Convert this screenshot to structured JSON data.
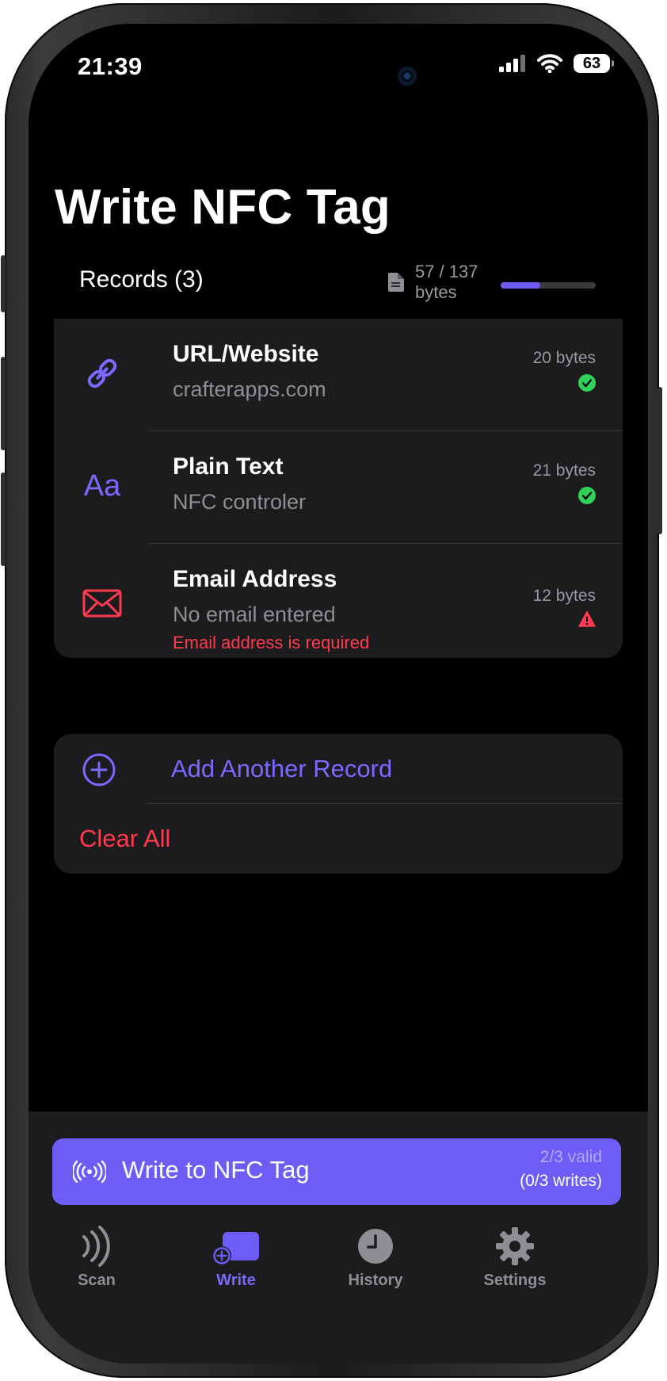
{
  "status_bar": {
    "time": "21:39",
    "battery": "63"
  },
  "page": {
    "title": "Write NFC Tag"
  },
  "records_header": {
    "label": "Records (3)",
    "bytes_used": "57 / 137",
    "bytes_unit": "bytes",
    "usage_fraction": 0.416
  },
  "records": [
    {
      "type_icon": "link-icon",
      "title": "URL/Website",
      "value": "crafterapps.com",
      "size": "20 bytes",
      "status": "valid",
      "error": ""
    },
    {
      "type_icon": "text-icon",
      "title": "Plain Text",
      "value": "NFC controler",
      "size": "21 bytes",
      "status": "valid",
      "error": ""
    },
    {
      "type_icon": "envelope-icon",
      "title": "Email Address",
      "value": "No email entered",
      "size": "12 bytes",
      "status": "error",
      "error": "Email address is required"
    }
  ],
  "actions": {
    "add_label": "Add Another Record",
    "clear_label": "Clear All"
  },
  "write_button": {
    "label": "Write to NFC Tag",
    "valid": "2/3 valid",
    "writes": "(0/3 writes)"
  },
  "tabs": [
    {
      "label": "Scan",
      "icon": "nfc-waves-icon",
      "active": false
    },
    {
      "label": "Write",
      "icon": "write-tag-icon",
      "active": true
    },
    {
      "label": "History",
      "icon": "clock-icon",
      "active": false
    },
    {
      "label": "Settings",
      "icon": "gear-icon",
      "active": false
    }
  ],
  "colors": {
    "accent": "#6E5CF7",
    "error": "#FF3A4F",
    "success": "#30D158",
    "card": "#1C1C1E"
  }
}
